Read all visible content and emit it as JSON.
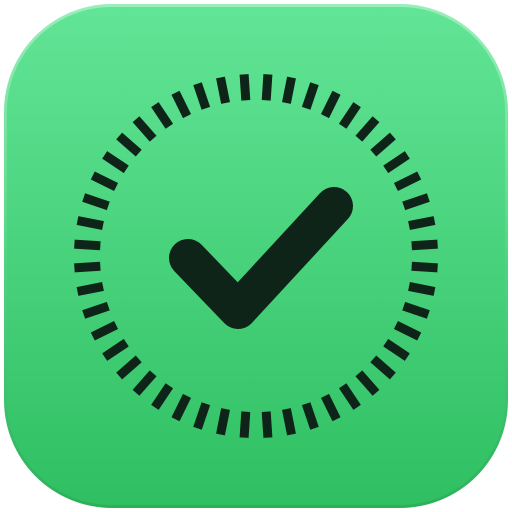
{
  "icon": {
    "name": "timed-checkmark-app-icon",
    "glyph": "checkmark-icon",
    "ring": "dashed-timer-ring-icon",
    "colors": {
      "tile_top": "#62E596",
      "tile_bottom": "#2FBF62",
      "tile_rim": "#8AF0B4",
      "ink": "#0F2418"
    },
    "ring_tick_count": 48
  }
}
